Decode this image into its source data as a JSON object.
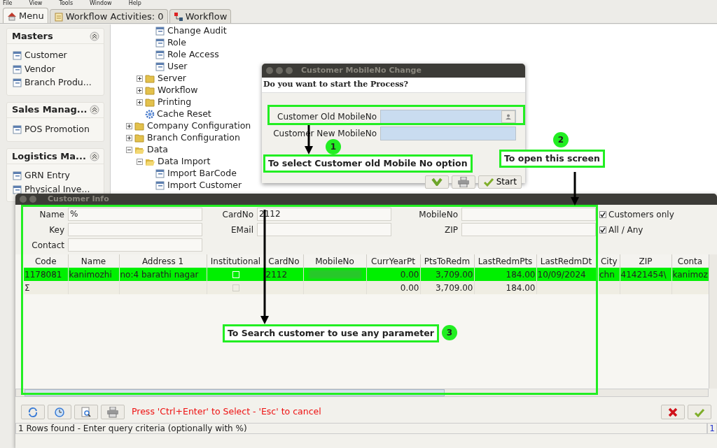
{
  "menubar": [
    "File",
    "View",
    "Tools",
    "Window",
    "Help"
  ],
  "tabs": [
    {
      "label": "Menu",
      "selected": true,
      "kind": "home"
    },
    {
      "label": "Workflow Activities: 0",
      "selected": false,
      "kind": "list"
    },
    {
      "label": "Workflow",
      "selected": false,
      "kind": "flow"
    }
  ],
  "sidebar": {
    "sections": [
      {
        "title": "Masters",
        "items": [
          "Customer",
          "Vendor",
          "Branch Produ..."
        ]
      },
      {
        "title": "Sales Manag...",
        "items": [
          "POS Promotion"
        ]
      },
      {
        "title": "Logistics Ma...",
        "items": [
          "GRN Entry",
          "Physical Inve..."
        ]
      }
    ]
  },
  "tree": [
    {
      "children": [
        {
          "children": [
            {
              "label": "Change Audit",
              "kind": "leaf"
            },
            {
              "label": "Role",
              "kind": "leaf"
            },
            {
              "label": "Role Access",
              "kind": "leaf"
            },
            {
              "label": "User",
              "kind": "leaf"
            }
          ]
        },
        {
          "label": "Server",
          "kind": "folder",
          "expanded": false
        },
        {
          "label": "Workflow",
          "kind": "folder",
          "expanded": false
        },
        {
          "label": "Printing",
          "kind": "folder",
          "expanded": false
        },
        {
          "label": "Cache Reset",
          "kind": "gear"
        }
      ]
    },
    {
      "label": "Company Configuration",
      "kind": "folder",
      "expanded": false
    },
    {
      "label": "Branch Configuration",
      "kind": "folder",
      "expanded": false
    },
    {
      "label": "Data",
      "kind": "folder",
      "expanded": true,
      "children": [
        {
          "label": "Data Import",
          "kind": "folder",
          "expanded": true,
          "children": [
            {
              "label": "Import BarCode",
              "kind": "leaf"
            },
            {
              "label": "Import Customer",
              "kind": "leaf"
            }
          ]
        }
      ]
    }
  ],
  "dialog": {
    "title": "Customer MobileNo Change",
    "prompt": "Do you want to start the Process?",
    "fields": [
      {
        "label": "Customer Old MobileNo",
        "lookup": true
      },
      {
        "label": "Customer New MobileNo",
        "lookup": false
      }
    ],
    "buttons": [
      {
        "kind": "down"
      },
      {
        "kind": "print"
      },
      {
        "kind": "ok",
        "label": "Start"
      }
    ]
  },
  "customer_info": {
    "title": "Customer Info",
    "filter_columns": [
      [
        {
          "label": "Name",
          "value": "%"
        },
        {
          "label": "Key"
        },
        {
          "label": "Contact"
        }
      ],
      [
        {
          "label": "CardNo",
          "value": "2112"
        },
        {
          "label": "EMail"
        }
      ],
      [
        {
          "label": "MobileNo"
        },
        {
          "label": "ZIP"
        }
      ]
    ],
    "options": [
      {
        "label": "Customers only",
        "checked": true
      },
      {
        "label": "All / Any",
        "checked": true
      }
    ],
    "table": {
      "columns": [
        "Code",
        "Name",
        "Address 1",
        "Institutional",
        "CardNo",
        "MobileNo",
        "CurrYearPt",
        "PtsToRedm",
        "LastRedmPts",
        "LastRedmDt",
        "City",
        "ZIP",
        "Conta"
      ],
      "rows": [
        {
          "selected": true,
          "cells": [
            "1178081",
            "kanimozhi",
            "no:4 barathi nagar",
            {
              "kind": "checkbox",
              "checked": false,
              "disabled": false
            },
            "2112",
            {
              "kind": "blurred"
            },
            "0.00",
            "3,709.00",
            "184.00",
            "10/09/2024",
            "chn",
            "41421454\\",
            "kanimoz"
          ]
        },
        {
          "selected": false,
          "cells": [
            "Σ",
            null,
            null,
            {
              "kind": "checkbox",
              "checked": false,
              "disabled": true
            },
            null,
            null,
            "0.00",
            "3,709.00",
            "184.00",
            null,
            null,
            null,
            null
          ]
        }
      ]
    },
    "toolbar": [
      {
        "kind": "refresh"
      },
      {
        "kind": "history"
      },
      {
        "kind": "zoom"
      },
      {
        "kind": "print"
      }
    ],
    "hint": "Press 'Ctrl+Enter' to Select - 'Esc' to cancel",
    "actions": [
      {
        "kind": "cancel"
      },
      {
        "kind": "ok"
      }
    ],
    "status": "1 Rows found - Enter query criteria (optionally with %)",
    "status_count": "1"
  },
  "annotations": [
    {
      "number": "1",
      "text": "To select Customer old Mobile No option"
    },
    {
      "number": "2",
      "text": "To open this screen"
    },
    {
      "number": "3",
      "text": "To Search customer to use any parameter"
    }
  ]
}
